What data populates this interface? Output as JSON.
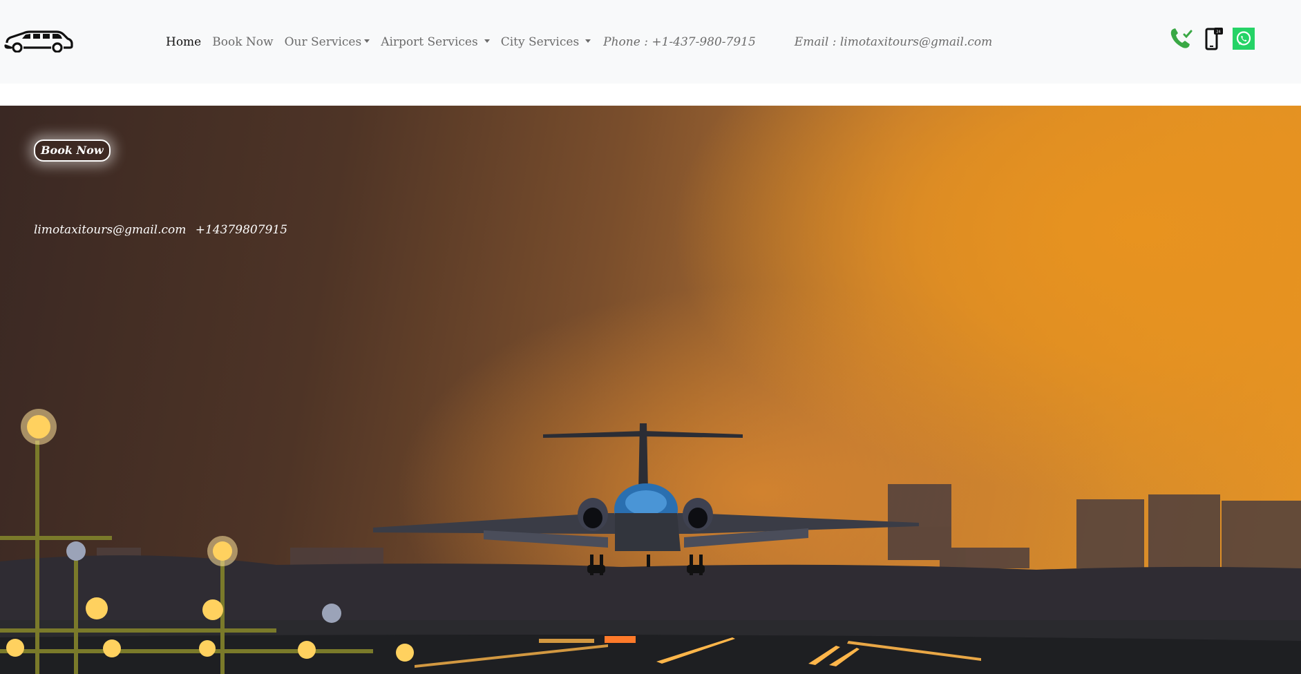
{
  "nav": {
    "items": [
      {
        "label": "Home",
        "active": true,
        "dropdown": false
      },
      {
        "label": "Book Now",
        "active": false,
        "dropdown": false
      },
      {
        "label": "Our Services",
        "active": false,
        "dropdown": true
      },
      {
        "label": "Airport Services",
        "active": false,
        "dropdown": true
      },
      {
        "label": "City Services",
        "active": false,
        "dropdown": true
      }
    ],
    "phone": "Phone : +1-437-980-7915",
    "email": "Email : limotaxitours@gmail.com"
  },
  "icons": {
    "logo": "limousine-icon",
    "call": "phone-call-icon",
    "mobile": "mobile-phone-icon",
    "whatsapp": "whatsapp-icon"
  },
  "hero": {
    "book_button": "Book Now",
    "email": "limotaxitours@gmail.com",
    "phone": "+14379807915"
  },
  "colors": {
    "navbar_bg": "#f8f9fa",
    "nav_active": "#111111",
    "nav_text": "#6b6b6b",
    "call_icon": "#3aa845",
    "whatsapp": "#25d366"
  }
}
